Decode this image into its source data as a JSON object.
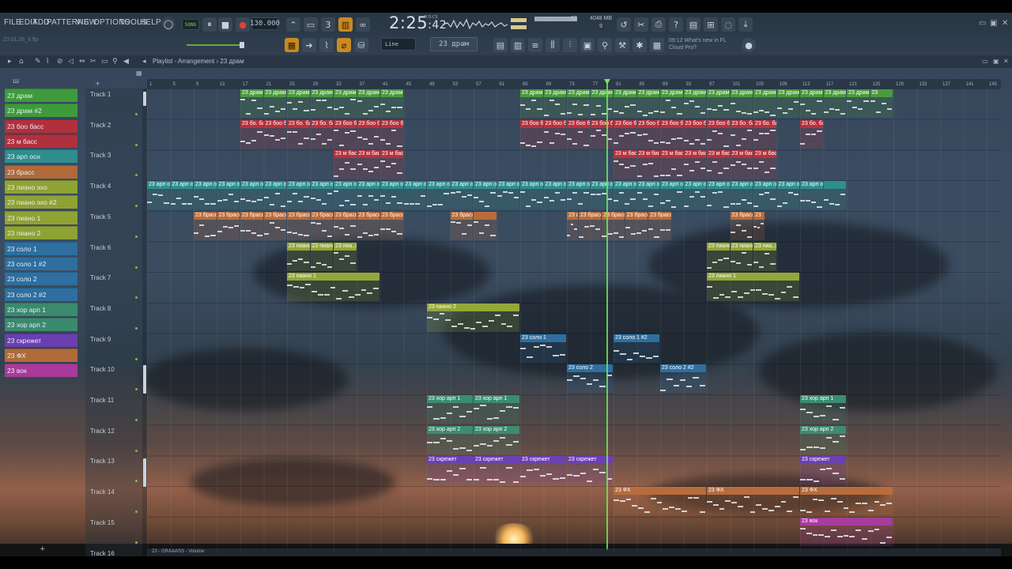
{
  "menu": [
    "FILE",
    "EDIT",
    "ADD",
    "PATTERNS",
    "VIEW",
    "OPTIONS",
    "TOOLS",
    "HELP"
  ],
  "hint_text": "23.01.26_6.flp",
  "transport": {
    "mode": "SONG",
    "tempo": "130.000",
    "time": "2:25",
    "time_frac": ":42",
    "time_units": "M:S:CS",
    "cpu_value": "52",
    "memory": "4048 MB",
    "polyphony": "9",
    "pattern_selector": "23 драм",
    "snap": "Line"
  },
  "news": {
    "time": "09:12",
    "line1": "What's new in FL",
    "line2": "Cloud Pro?"
  },
  "playlist": {
    "title": "Playlist - Arrangement",
    "separator": "›",
    "current_pattern": "23 драм"
  },
  "patterns": [
    {
      "name": "23 драм",
      "color": "#3f9a3c"
    },
    {
      "name": "23 драм #2",
      "color": "#3f9a3c"
    },
    {
      "name": "23 бoo басс",
      "color": "#b0313d"
    },
    {
      "name": "23 м басс",
      "color": "#b0313d"
    },
    {
      "name": "23 арп осн",
      "color": "#2f8d8e"
    },
    {
      "name": "23 брасс",
      "color": "#b06a3a"
    },
    {
      "name": "23 пиано эхо",
      "color": "#8fa234"
    },
    {
      "name": "23 пиано эхо #2",
      "color": "#8fa234"
    },
    {
      "name": "23 пиано 1",
      "color": "#8fa234"
    },
    {
      "name": "23 пиано 2",
      "color": "#8fa234"
    },
    {
      "name": "23 соло 1",
      "color": "#2e6f9f"
    },
    {
      "name": "23 соло 1 #2",
      "color": "#2e6f9f"
    },
    {
      "name": "23 соло 2",
      "color": "#2e6f9f"
    },
    {
      "name": "23 соло 2 #2",
      "color": "#2e6f9f"
    },
    {
      "name": "23 хор арп 1",
      "color": "#3b8a6e"
    },
    {
      "name": "23 хор арп 2",
      "color": "#3b8a6e"
    },
    {
      "name": "23 скрежет",
      "color": "#6a3fb0"
    },
    {
      "name": "23 ФХ",
      "color": "#b06a3a"
    },
    {
      "name": "23 вок",
      "color": "#a83a9a"
    }
  ],
  "ruler": [
    "1",
    "5",
    "9",
    "13",
    "17",
    "21",
    "25",
    "29",
    "33",
    "37",
    "41",
    "45",
    "49",
    "53",
    "57",
    "61",
    "65",
    "69",
    "73",
    "77",
    "81",
    "85",
    "89",
    "93",
    "97",
    "101",
    "105",
    "109",
    "113",
    "117",
    "121",
    "125",
    "129",
    "133",
    "137",
    "141",
    "145"
  ],
  "tracks": [
    "Track 1",
    "Track 2",
    "Track 3",
    "Track 4",
    "Track 5",
    "Track 6",
    "Track 7",
    "Track 8",
    "Track 9",
    "Track 10",
    "Track 11",
    "Track 12",
    "Track 13",
    "Track 14",
    "Track 15",
    "Track 16"
  ],
  "clips": [
    {
      "track": 0,
      "start": 17,
      "len": 4,
      "label": "23 драм",
      "color": "#4a9a3d"
    },
    {
      "track": 0,
      "start": 21,
      "len": 4,
      "label": "23 драм #2",
      "color": "#4a9a3d"
    },
    {
      "track": 0,
      "start": 25,
      "len": 4,
      "label": "23 драм #2",
      "color": "#4a9a3d"
    },
    {
      "track": 0,
      "start": 29,
      "len": 4,
      "label": "23 драм",
      "color": "#4a9a3d"
    },
    {
      "track": 0,
      "start": 33,
      "len": 4,
      "label": "23 драм #2",
      "color": "#4a9a3d"
    },
    {
      "track": 0,
      "start": 37,
      "len": 4,
      "label": "23 драм #2",
      "color": "#4a9a3d"
    },
    {
      "track": 0,
      "start": 41,
      "len": 4,
      "label": "23 драм",
      "color": "#4a9a3d"
    },
    {
      "track": 0,
      "start": 65,
      "len": 4,
      "label": "23 драм #2",
      "color": "#4a9a3d"
    },
    {
      "track": 0,
      "start": 69,
      "len": 4,
      "label": "23 драм #2",
      "color": "#4a9a3d"
    },
    {
      "track": 0,
      "start": 73,
      "len": 4,
      "label": "23 драм #2",
      "color": "#4a9a3d"
    },
    {
      "track": 0,
      "start": 77,
      "len": 4,
      "label": "23 драм #2",
      "color": "#4a9a3d"
    },
    {
      "track": 0,
      "start": 81,
      "len": 4,
      "label": "23 драм",
      "color": "#4a9a3d"
    },
    {
      "track": 0,
      "start": 85,
      "len": 4,
      "label": "23 драм",
      "color": "#4a9a3d"
    },
    {
      "track": 0,
      "start": 89,
      "len": 4,
      "label": "23 драм #2",
      "color": "#4a9a3d"
    },
    {
      "track": 0,
      "start": 93,
      "len": 4,
      "label": "23 драм",
      "color": "#4a9a3d"
    },
    {
      "track": 0,
      "start": 97,
      "len": 4,
      "label": "23 драм",
      "color": "#4a9a3d"
    },
    {
      "track": 0,
      "start": 101,
      "len": 4,
      "label": "23 драм #2",
      "color": "#4a9a3d"
    },
    {
      "track": 0,
      "start": 105,
      "len": 4,
      "label": "23 драм",
      "color": "#4a9a3d"
    },
    {
      "track": 0,
      "start": 109,
      "len": 4,
      "label": "23 драм",
      "color": "#4a9a3d"
    },
    {
      "track": 0,
      "start": 113,
      "len": 4,
      "label": "23 драм #2",
      "color": "#4a9a3d"
    },
    {
      "track": 0,
      "start": 117,
      "len": 4,
      "label": "23 драм",
      "color": "#4a9a3d"
    },
    {
      "track": 0,
      "start": 121,
      "len": 4,
      "label": "23 драм",
      "color": "#4a9a3d"
    },
    {
      "track": 0,
      "start": 125,
      "len": 4,
      "label": "23",
      "color": "#4a9a3d"
    },
    {
      "track": 1,
      "start": 17,
      "len": 4,
      "label": "23 бо. басс",
      "color": "#b8323d"
    },
    {
      "track": 1,
      "start": 21,
      "len": 4,
      "label": "23 боо басс",
      "color": "#b8323d"
    },
    {
      "track": 1,
      "start": 25,
      "len": 4,
      "label": "23 бо. басс",
      "color": "#b8323d"
    },
    {
      "track": 1,
      "start": 29,
      "len": 4,
      "label": "23 бо. басс",
      "color": "#b8323d"
    },
    {
      "track": 1,
      "start": 33,
      "len": 4,
      "label": "23 боо басс",
      "color": "#b8323d"
    },
    {
      "track": 1,
      "start": 37,
      "len": 4,
      "label": "23 боо басс",
      "color": "#b8323d"
    },
    {
      "track": 1,
      "start": 41,
      "len": 4,
      "label": "23 боо басс",
      "color": "#b8323d"
    },
    {
      "track": 1,
      "start": 65,
      "len": 4,
      "label": "23 боо басс",
      "color": "#b8323d"
    },
    {
      "track": 1,
      "start": 69,
      "len": 4,
      "label": "23 боо басс",
      "color": "#b8323d"
    },
    {
      "track": 1,
      "start": 73,
      "len": 4,
      "label": "23 боо басс",
      "color": "#b8323d"
    },
    {
      "track": 1,
      "start": 77,
      "len": 4,
      "label": "23 боо басс",
      "color": "#b8323d"
    },
    {
      "track": 1,
      "start": 81,
      "len": 4,
      "label": "23 боо басс",
      "color": "#b8323d"
    },
    {
      "track": 1,
      "start": 85,
      "len": 4,
      "label": "23 боо басс",
      "color": "#b8323d"
    },
    {
      "track": 1,
      "start": 89,
      "len": 4,
      "label": "23 боо басс",
      "color": "#b8323d"
    },
    {
      "track": 1,
      "start": 93,
      "len": 4,
      "label": "23 боо басс",
      "color": "#b8323d"
    },
    {
      "track": 1,
      "start": 97,
      "len": 4,
      "label": "23 боо басс",
      "color": "#b8323d"
    },
    {
      "track": 1,
      "start": 101,
      "len": 4,
      "label": "23 бо. басс",
      "color": "#b8323d"
    },
    {
      "track": 1,
      "start": 105,
      "len": 4,
      "label": "23 бо. басс",
      "color": "#b8323d"
    },
    {
      "track": 1,
      "start": 113,
      "len": 4,
      "label": "23 бо. басс",
      "color": "#b8323d"
    },
    {
      "track": 2,
      "start": 33,
      "len": 4,
      "label": "23 м басс",
      "color": "#b8323d"
    },
    {
      "track": 2,
      "start": 37,
      "len": 4,
      "label": "23 м басс",
      "color": "#b8323d"
    },
    {
      "track": 2,
      "start": 41,
      "len": 4,
      "label": "23 м басс",
      "color": "#b8323d"
    },
    {
      "track": 2,
      "start": 81,
      "len": 4,
      "label": "23 м басс",
      "color": "#b8323d"
    },
    {
      "track": 2,
      "start": 85,
      "len": 4,
      "label": "23 м басс",
      "color": "#b8323d"
    },
    {
      "track": 2,
      "start": 89,
      "len": 4,
      "label": "23 м басс",
      "color": "#b8323d"
    },
    {
      "track": 2,
      "start": 93,
      "len": 4,
      "label": "23 м басс",
      "color": "#b8323d"
    },
    {
      "track": 2,
      "start": 97,
      "len": 4,
      "label": "23 м басс",
      "color": "#b8323d"
    },
    {
      "track": 2,
      "start": 101,
      "len": 4,
      "label": "23 м басс",
      "color": "#b8323d"
    },
    {
      "track": 2,
      "start": 105,
      "len": 4,
      "label": "23 м басс",
      "color": "#b8323d"
    },
    {
      "track": 3,
      "start": 1,
      "len": 4,
      "label": "23 арп осн",
      "color": "#2e8f8e"
    },
    {
      "track": 3,
      "start": 5,
      "len": 4,
      "label": "23 арп осн",
      "color": "#2e8f8e"
    },
    {
      "track": 3,
      "start": 9,
      "len": 4,
      "label": "23 арп осн",
      "color": "#2e8f8e"
    },
    {
      "track": 3,
      "start": 13,
      "len": 4,
      "label": "23 арп осн",
      "color": "#2e8f8e"
    },
    {
      "track": 3,
      "start": 17,
      "len": 4,
      "label": "23 арп осн",
      "color": "#2e8f8e"
    },
    {
      "track": 3,
      "start": 21,
      "len": 4,
      "label": "23 арп осн",
      "color": "#2e8f8e"
    },
    {
      "track": 3,
      "start": 25,
      "len": 4,
      "label": "23 арп осн",
      "color": "#2e8f8e"
    },
    {
      "track": 3,
      "start": 29,
      "len": 4,
      "label": "23 арп осн",
      "color": "#2e8f8e"
    },
    {
      "track": 3,
      "start": 33,
      "len": 4,
      "label": "23 арп осн",
      "color": "#2e8f8e"
    },
    {
      "track": 3,
      "start": 37,
      "len": 4,
      "label": "23 арп осн",
      "color": "#2e8f8e"
    },
    {
      "track": 3,
      "start": 41,
      "len": 4,
      "label": "23 арп осн",
      "color": "#2e8f8e"
    },
    {
      "track": 3,
      "start": 45,
      "len": 4,
      "label": "23 арп осн",
      "color": "#2e8f8e"
    },
    {
      "track": 3,
      "start": 49,
      "len": 4,
      "label": "23 арп осн",
      "color": "#2e8f8e"
    },
    {
      "track": 3,
      "start": 53,
      "len": 4,
      "label": "23 арп осн",
      "color": "#2e8f8e"
    },
    {
      "track": 3,
      "start": 57,
      "len": 4,
      "label": "23 арп осн",
      "color": "#2e8f8e"
    },
    {
      "track": 3,
      "start": 61,
      "len": 4,
      "label": "23 арп осн",
      "color": "#2e8f8e"
    },
    {
      "track": 3,
      "start": 65,
      "len": 4,
      "label": "23 арп осн",
      "color": "#2e8f8e"
    },
    {
      "track": 3,
      "start": 69,
      "len": 4,
      "label": "23 арп осн",
      "color": "#2e8f8e"
    },
    {
      "track": 3,
      "start": 73,
      "len": 4,
      "label": "23 арп осн",
      "color": "#2e8f8e"
    },
    {
      "track": 3,
      "start": 77,
      "len": 4,
      "label": "23 арп осн",
      "color": "#2e8f8e"
    },
    {
      "track": 3,
      "start": 81,
      "len": 4,
      "label": "23 арп осн",
      "color": "#2e8f8e"
    },
    {
      "track": 3,
      "start": 85,
      "len": 4,
      "label": "23 арп осн",
      "color": "#2e8f8e"
    },
    {
      "track": 3,
      "start": 89,
      "len": 4,
      "label": "23 арп осн",
      "color": "#2e8f8e"
    },
    {
      "track": 3,
      "start": 93,
      "len": 4,
      "label": "23 арп осн",
      "color": "#2e8f8e"
    },
    {
      "track": 3,
      "start": 97,
      "len": 4,
      "label": "23 арп осн",
      "color": "#2e8f8e"
    },
    {
      "track": 3,
      "start": 101,
      "len": 4,
      "label": "23 арп осн",
      "color": "#2e8f8e"
    },
    {
      "track": 3,
      "start": 105,
      "len": 4,
      "label": "23 арп осн",
      "color": "#2e8f8e"
    },
    {
      "track": 3,
      "start": 109,
      "len": 4,
      "label": "23 арп осн",
      "color": "#2e8f8e"
    },
    {
      "track": 3,
      "start": 113,
      "len": 4,
      "label": "23 арп осн",
      "color": "#2e8f8e"
    },
    {
      "track": 3,
      "start": 117,
      "len": 4,
      "label": "",
      "color": "#2e8f8e"
    },
    {
      "track": 4,
      "start": 9,
      "len": 4,
      "label": "23 брасс",
      "color": "#b86c3c"
    },
    {
      "track": 4,
      "start": 13,
      "len": 4,
      "label": "23 брасс",
      "color": "#b86c3c"
    },
    {
      "track": 4,
      "start": 17,
      "len": 4,
      "label": "23 брасс",
      "color": "#b86c3c"
    },
    {
      "track": 4,
      "start": 21,
      "len": 4,
      "label": "23 брасс",
      "color": "#b86c3c"
    },
    {
      "track": 4,
      "start": 25,
      "len": 4,
      "label": "23 брасс",
      "color": "#b86c3c"
    },
    {
      "track": 4,
      "start": 29,
      "len": 4,
      "label": "23 брасс",
      "color": "#b86c3c"
    },
    {
      "track": 4,
      "start": 33,
      "len": 4,
      "label": "23 брасс",
      "color": "#b86c3c"
    },
    {
      "track": 4,
      "start": 37,
      "len": 4,
      "label": "23 брасс",
      "color": "#b86c3c"
    },
    {
      "track": 4,
      "start": 41,
      "len": 4,
      "label": "23 брасс",
      "color": "#b86c3c"
    },
    {
      "track": 4,
      "start": 53,
      "len": 4,
      "label": "23 брасс",
      "color": "#b86c3c"
    },
    {
      "track": 4,
      "start": 57,
      "len": 4,
      "label": "",
      "color": "#b86c3c"
    },
    {
      "track": 4,
      "start": 73,
      "len": 2,
      "label": "23 сс",
      "color": "#b86c3c"
    },
    {
      "track": 4,
      "start": 75,
      "len": 4,
      "label": "23 брасс",
      "color": "#b86c3c"
    },
    {
      "track": 4,
      "start": 79,
      "len": 4,
      "label": "23 брасс",
      "color": "#b86c3c"
    },
    {
      "track": 4,
      "start": 83,
      "len": 4,
      "label": "23 брасс",
      "color": "#b86c3c"
    },
    {
      "track": 4,
      "start": 87,
      "len": 4,
      "label": "23 брасс",
      "color": "#b86c3c"
    },
    {
      "track": 4,
      "start": 101,
      "len": 4,
      "label": "23 брасс",
      "color": "#b86c3c"
    },
    {
      "track": 4,
      "start": 105,
      "len": 2,
      "label": "23",
      "color": "#b86c3c"
    },
    {
      "track": 5,
      "start": 25,
      "len": 4,
      "label": "23 пиано эхо",
      "color": "#93a838"
    },
    {
      "track": 5,
      "start": 29,
      "len": 4,
      "label": "23 пиано эхо",
      "color": "#93a838"
    },
    {
      "track": 5,
      "start": 33,
      "len": 4,
      "label": "23 пиа..эхо #2",
      "color": "#93a838"
    },
    {
      "track": 5,
      "start": 97,
      "len": 4,
      "label": "23 пиано эхо",
      "color": "#93a838"
    },
    {
      "track": 5,
      "start": 101,
      "len": 4,
      "label": "23 пиано эхо",
      "color": "#93a838"
    },
    {
      "track": 5,
      "start": 105,
      "len": 4,
      "label": "23 пиа..эхо #2",
      "color": "#93a838"
    },
    {
      "track": 6,
      "start": 25,
      "len": 16,
      "label": "23 пиано 1",
      "color": "#93a838"
    },
    {
      "track": 6,
      "start": 97,
      "len": 16,
      "label": "23 пиано 1",
      "color": "#93a838"
    },
    {
      "track": 7,
      "start": 49,
      "len": 16,
      "label": "23 пиано 2",
      "color": "#93a838"
    },
    {
      "track": 8,
      "start": 65,
      "len": 8,
      "label": "23 соло 1",
      "color": "#2e6fa0"
    },
    {
      "track": 8,
      "start": 81,
      "len": 8,
      "label": "23 соло 1 #2",
      "color": "#2e6fa0"
    },
    {
      "track": 9,
      "start": 73,
      "len": 8,
      "label": "23 соло 2",
      "color": "#2e6fa0"
    },
    {
      "track": 9,
      "start": 89,
      "len": 8,
      "label": "23 соло 2 #2",
      "color": "#2e6fa0"
    },
    {
      "track": 10,
      "start": 49,
      "len": 8,
      "label": "23 хор арп 1",
      "color": "#3b8c70"
    },
    {
      "track": 10,
      "start": 57,
      "len": 8,
      "label": "23 хор арп 1",
      "color": "#3b8c70"
    },
    {
      "track": 10,
      "start": 113,
      "len": 8,
      "label": "23 хор арп 1",
      "color": "#3b8c70"
    },
    {
      "track": 11,
      "start": 49,
      "len": 8,
      "label": "23 хор арп 2",
      "color": "#3b8c70"
    },
    {
      "track": 11,
      "start": 57,
      "len": 8,
      "label": "23 хор арп 2",
      "color": "#3b8c70"
    },
    {
      "track": 11,
      "start": 113,
      "len": 8,
      "label": "23 хор арп 2",
      "color": "#3b8c70"
    },
    {
      "track": 12,
      "start": 49,
      "len": 8,
      "label": "23 скрежет",
      "color": "#6c40b4"
    },
    {
      "track": 12,
      "start": 57,
      "len": 8,
      "label": "23 скрежет",
      "color": "#6c40b4"
    },
    {
      "track": 12,
      "start": 65,
      "len": 8,
      "label": "23 скрежет",
      "color": "#6c40b4"
    },
    {
      "track": 12,
      "start": 73,
      "len": 8,
      "label": "23 скрежет",
      "color": "#6c40b4"
    },
    {
      "track": 12,
      "start": 113,
      "len": 8,
      "label": "23 скрежет",
      "color": "#6c40b4"
    },
    {
      "track": 13,
      "start": 81,
      "len": 16,
      "label": "23 ФХ",
      "color": "#b86c3c"
    },
    {
      "track": 13,
      "start": 97,
      "len": 16,
      "label": "23 ФХ",
      "color": "#b86c3c"
    },
    {
      "track": 13,
      "start": 113,
      "len": 16,
      "label": "23 ФХ",
      "color": "#b86c3c"
    },
    {
      "track": 14,
      "start": 113,
      "len": 16,
      "label": "23 вок",
      "color": "#a83c9c"
    }
  ],
  "bottom_strip": "23 - GRAAASS - Volume",
  "icons": [
    "search-icon",
    "record-icon",
    "play-icon",
    "stop-icon",
    "metronome-icon",
    "snap-icon",
    "pencil-icon",
    "brush-icon",
    "eraser-icon",
    "mute-icon",
    "slice-icon",
    "zoom-icon",
    "playback-icon",
    "close-icon",
    "minimize-icon",
    "maximize-icon"
  ]
}
